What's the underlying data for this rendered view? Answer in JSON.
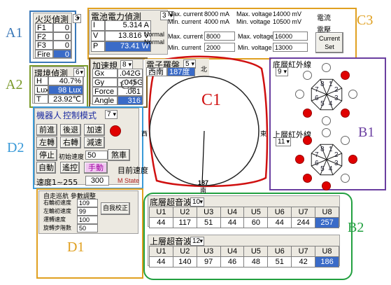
{
  "annotations": {
    "a1": "A1",
    "a2": "A2",
    "c1": "C1",
    "c2": "C2",
    "c3": "C3",
    "d1": "D1",
    "d2": "D2",
    "b1": "B1",
    "b2": "B2"
  },
  "fire": {
    "title": "火災偵測",
    "dropdown": "3",
    "rows": [
      {
        "label": "F1",
        "value": "0"
      },
      {
        "label": "F2",
        "value": "0"
      },
      {
        "label": "F3",
        "value": "0"
      },
      {
        "label": "Fire",
        "value": "0"
      }
    ]
  },
  "env": {
    "title": "環境偵測",
    "dropdown": "6",
    "rows": [
      {
        "label": "H",
        "value": "40.7%"
      },
      {
        "label": "Lux",
        "value": "98 Lux"
      },
      {
        "label": "T",
        "value": "23.92℃"
      }
    ]
  },
  "battery": {
    "title": "電池電力偵測",
    "dropdown": "3",
    "rows": [
      {
        "label": "I",
        "value": "5.314 A"
      },
      {
        "label": "V",
        "value": "13.816 V"
      },
      {
        "label": "P",
        "value": "73.41 W"
      }
    ],
    "normal1": "Normal",
    "normal2": "Normal",
    "stats": [
      {
        "k": "Max. current",
        "v": "8000 mA",
        "k2": "Max. voltage",
        "v2": "14000 mV"
      },
      {
        "k": "Min. current",
        "v": "4000 mA",
        "k2": "Min. voltage",
        "v2": "10500 mV"
      }
    ],
    "set": [
      {
        "k": "Max. current",
        "v": "8000",
        "k2": "Max. voltage",
        "v2": "16000"
      },
      {
        "k": "Min. current",
        "v": "2000",
        "k2": "Min. voltage",
        "v2": "13000"
      }
    ],
    "label_current": "電流",
    "label_voltage": "電壓",
    "set_button": "Current Set"
  },
  "accel": {
    "title": "加速規",
    "dropdown": "8",
    "rows": [
      {
        "label": "Gx",
        "value": ".042G"
      },
      {
        "label": "Gy",
        "value": "-.045G"
      },
      {
        "label": "Force",
        "value": ".061"
      },
      {
        "label": "Angle",
        "value": "316"
      }
    ]
  },
  "compass": {
    "title": "電子羅盤",
    "dropdown": "5",
    "dir": "西南",
    "deg": "187度",
    "north": "北",
    "south": "南",
    "west": "西",
    "east": "東",
    "needle": "187"
  },
  "robot": {
    "title": "機器人",
    "mode_label": "控制模式",
    "mode_value": "7",
    "buttons": [
      "前進",
      "後退",
      "加速",
      "左轉",
      "右轉",
      "減速",
      "停止"
    ],
    "init_speed_label": "初始速度",
    "init_speed_value": "50",
    "brake": "煞車",
    "auto": "自動",
    "remote": "遙控",
    "manual": "手動",
    "target_speed": "目前速度",
    "speed_range": "速度1~255",
    "speed_value": "300",
    "m_state": "M State"
  },
  "tuning": {
    "title": "自走巡航 參數調整",
    "rows": [
      {
        "label": "右輪初速度",
        "value": "109"
      },
      {
        "label": "左輪初速度",
        "value": "99"
      },
      {
        "label": "運轉速度",
        "value": "100"
      },
      {
        "label": "旋轉步階數",
        "value": "50"
      }
    ],
    "button": "自我校正"
  },
  "ir_lower": {
    "title": "底層紅外線",
    "dropdown": "9",
    "numbers": [
      "1",
      "2",
      "3",
      "4",
      "5",
      "6",
      "7",
      "8"
    ],
    "states": [
      false,
      true,
      false,
      true,
      false,
      true,
      false,
      false
    ]
  },
  "ir_upper": {
    "title": "上層紅外線",
    "dropdown": "11",
    "numbers": [
      "1",
      "2",
      "3",
      "4",
      "5",
      "6",
      "7",
      "8"
    ],
    "states": [
      false,
      false,
      true,
      false,
      true,
      true,
      true,
      true
    ]
  },
  "us_lower": {
    "title": "底層超音波",
    "dropdown": "10",
    "headers": [
      "U1",
      "U2",
      "U3",
      "U4",
      "U5",
      "U6",
      "U7",
      "U8"
    ],
    "values": [
      "44",
      "117",
      "51",
      "44",
      "60",
      "44",
      "244",
      "257"
    ],
    "selected_index": 7
  },
  "us_upper": {
    "title": "上層超音波",
    "dropdown": "12",
    "headers": [
      "U1",
      "U2",
      "U3",
      "U4",
      "U5",
      "U6",
      "U7",
      "U8"
    ],
    "values": [
      "44",
      "140",
      "97",
      "46",
      "48",
      "51",
      "42",
      "186"
    ],
    "selected_index": 7
  },
  "colors": {
    "ann_blue": "#3a78b8",
    "ann_red": "#d01010",
    "ann_orange": "#e0a020",
    "ann_purple": "#6a3ea0",
    "ann_green": "#22a040",
    "sel": "#3a6bc8",
    "led_on": "#e00000"
  }
}
